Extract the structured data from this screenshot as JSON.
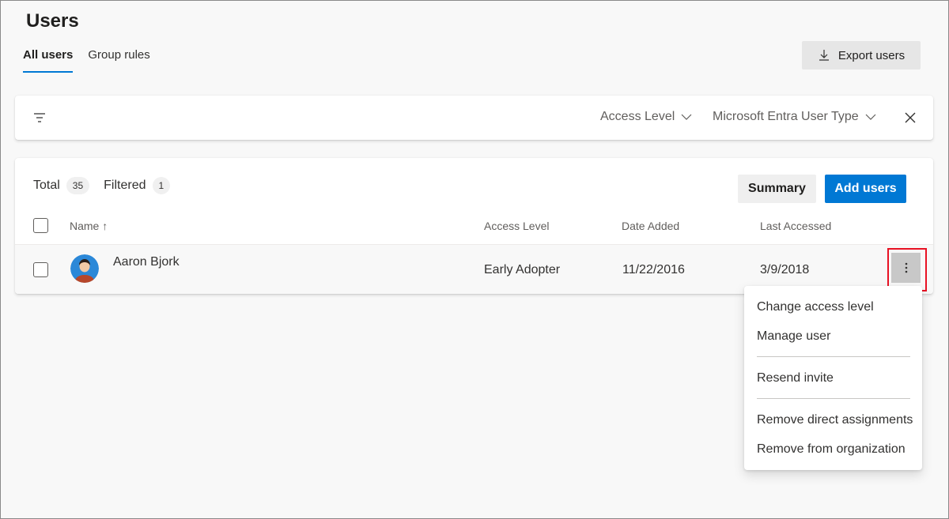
{
  "page": {
    "title": "Users"
  },
  "tabs": [
    {
      "label": "All users",
      "active": true
    },
    {
      "label": "Group rules",
      "active": false
    }
  ],
  "toolbar": {
    "export_label": "Export users",
    "export_icon": "download-icon"
  },
  "filters": {
    "filter_icon": "filter-icon",
    "access_level": "Access Level",
    "user_type": "Microsoft Entra User Type",
    "close_icon": "close-icon"
  },
  "summary_bar": {
    "total_label": "Total",
    "total_count": "35",
    "filtered_label": "Filtered",
    "filtered_count": "1",
    "summary_button": "Summary",
    "add_button": "Add users"
  },
  "table": {
    "columns": [
      "Name ↑",
      "Access Level",
      "Date Added",
      "Last Accessed"
    ],
    "rows": [
      {
        "name": "Aaron Bjork",
        "access_level": "Early Adopter",
        "date_added": "11/22/2016",
        "last_accessed": "3/9/2018"
      }
    ]
  },
  "context_menu": {
    "items": [
      "Change access level",
      "Manage user",
      "Resend invite",
      "Remove direct assignments",
      "Remove from organization"
    ]
  },
  "colors": {
    "accent": "#0078d4",
    "highlight": "#e81123",
    "background": "#f8f8f8"
  }
}
